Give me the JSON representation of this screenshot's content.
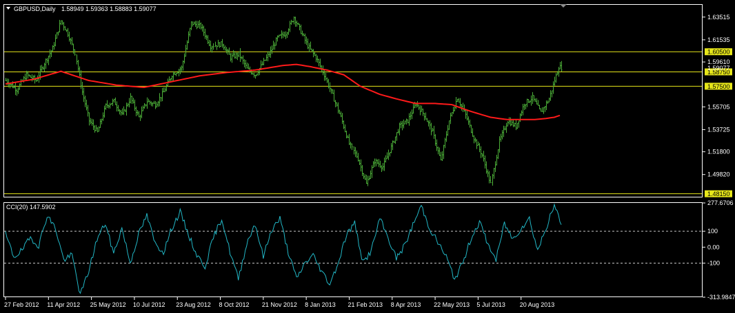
{
  "header": {
    "dropdown_icon": "triangle-down-icon",
    "symbol": "GBPUSD,Daily",
    "ohlc": "1.58949 1.59363 1.58883 1.59077"
  },
  "indicator": {
    "label": "CCI(20) 147.5902"
  },
  "colors": {
    "background": "#000000",
    "candle": "#4caf38",
    "moving_average": "#ff1a1a",
    "level_lines": "#e6e61a",
    "cci_line": "#22b7c6",
    "frame": "#ffffff"
  },
  "chart_data": [
    {
      "type": "line",
      "subtype": "price-bars",
      "title": "",
      "ylim": [
        1.4783,
        1.6458
      ],
      "y_ticks": [
        "1.63515",
        "1.61535",
        "1.59610",
        "1.55705",
        "1.53725",
        "1.51800",
        "1.49820"
      ],
      "price_badges": [
        "1.60500",
        "1.58750",
        "1.57500",
        "1.48150"
      ],
      "horizontal_levels": [
        1.605,
        1.5875,
        1.575,
        1.4815
      ],
      "current_price_label": "1.59077",
      "x_labels": [
        "27 Feb 2012",
        "11 Apr 2012",
        "25 May 2012",
        "10 Jul 2012",
        "23 Aug 2012",
        "8 Oct 2012",
        "21 Nov 2012",
        "8 Jan 2013",
        "21 Feb 2013",
        "8 Apr 2013",
        "22 May 2013",
        "5 Jul 2013",
        "20 Aug 2013"
      ],
      "x_positions": [
        0,
        31,
        62,
        93,
        124,
        155,
        186,
        217,
        248,
        279,
        310,
        341,
        372
      ],
      "total_bars": 402,
      "series": [
        {
          "role": "price",
          "x": [
            0,
            8,
            15,
            22,
            28,
            34,
            40,
            45,
            50,
            55,
            60,
            66,
            72,
            78,
            84,
            90,
            96,
            102,
            108,
            114,
            120,
            127,
            134,
            141,
            148,
            156,
            162,
            168,
            174,
            180,
            186,
            191,
            196,
            202,
            208,
            214,
            218,
            224,
            230,
            236,
            242,
            248,
            254,
            260,
            266,
            272,
            278,
            284,
            290,
            296,
            302,
            308,
            314,
            320,
            326,
            332,
            338,
            344,
            350,
            356,
            362,
            368,
            374,
            380,
            386,
            392,
            396,
            399,
            401
          ],
          "values": [
            1.58,
            1.572,
            1.585,
            1.58,
            1.595,
            1.608,
            1.632,
            1.621,
            1.604,
            1.57,
            1.545,
            1.535,
            1.558,
            1.562,
            1.55,
            1.565,
            1.548,
            1.562,
            1.559,
            1.57,
            1.585,
            1.591,
            1.63,
            1.627,
            1.61,
            1.612,
            1.6,
            1.603,
            1.59,
            1.585,
            1.596,
            1.605,
            1.617,
            1.621,
            1.635,
            1.62,
            1.61,
            1.6,
            1.585,
            1.567,
            1.548,
            1.525,
            1.512,
            1.49,
            1.51,
            1.505,
            1.522,
            1.54,
            1.545,
            1.56,
            1.55,
            1.535,
            1.51,
            1.545,
            1.565,
            1.55,
            1.53,
            1.515,
            1.49,
            1.527,
            1.545,
            1.54,
            1.56,
            1.565,
            1.552,
            1.564,
            1.58,
            1.592,
            1.591
          ]
        },
        {
          "role": "moving-average",
          "x": [
            0,
            20,
            40,
            60,
            80,
            100,
            120,
            140,
            160,
            180,
            200,
            210,
            220,
            232,
            244,
            256,
            270,
            282,
            296,
            310,
            322,
            336,
            350,
            362,
            372,
            382,
            390,
            396,
            401
          ],
          "values": [
            1.577,
            1.581,
            1.588,
            1.58,
            1.576,
            1.574,
            1.579,
            1.584,
            1.587,
            1.589,
            1.593,
            1.594,
            1.592,
            1.589,
            1.585,
            1.575,
            1.568,
            1.564,
            1.56,
            1.56,
            1.559,
            1.553,
            1.548,
            1.546,
            1.546,
            1.546,
            1.547,
            1.548,
            1.55
          ]
        }
      ]
    },
    {
      "type": "line",
      "title": "CCI(20) 147.5902",
      "ylim": [
        -313.9847,
        277.6706
      ],
      "y_ticks": [
        "277.6706",
        "100",
        "0.00",
        "-100",
        "-313.9847"
      ],
      "reference_lines": [
        100,
        -100
      ],
      "x": [
        0,
        6,
        12,
        18,
        24,
        30,
        36,
        42,
        48,
        54,
        60,
        66,
        72,
        78,
        84,
        90,
        96,
        102,
        108,
        114,
        120,
        126,
        132,
        138,
        144,
        150,
        156,
        162,
        168,
        174,
        180,
        186,
        192,
        198,
        204,
        210,
        216,
        222,
        228,
        234,
        240,
        246,
        252,
        258,
        264,
        270,
        276,
        282,
        288,
        294,
        300,
        306,
        312,
        318,
        324,
        330,
        336,
        342,
        348,
        354,
        360,
        366,
        372,
        378,
        384,
        390,
        396,
        401
      ],
      "series": [
        {
          "name": "CCI(20)",
          "values": [
            80,
            -60,
            -20,
            60,
            10,
            200,
            120,
            -80,
            -50,
            -300,
            -150,
            50,
            150,
            -40,
            120,
            -100,
            80,
            200,
            20,
            -30,
            120,
            220,
            80,
            -50,
            -120,
            60,
            180,
            -30,
            -200,
            20,
            150,
            -60,
            110,
            180,
            -30,
            -200,
            -100,
            -50,
            -150,
            -230,
            -100,
            80,
            150,
            -100,
            -20,
            180,
            60,
            -70,
            10,
            140,
            260,
            120,
            30,
            -60,
            -200,
            -100,
            60,
            160,
            20,
            -80,
            150,
            50,
            120,
            180,
            -20,
            120,
            260,
            148
          ]
        }
      ]
    }
  ]
}
